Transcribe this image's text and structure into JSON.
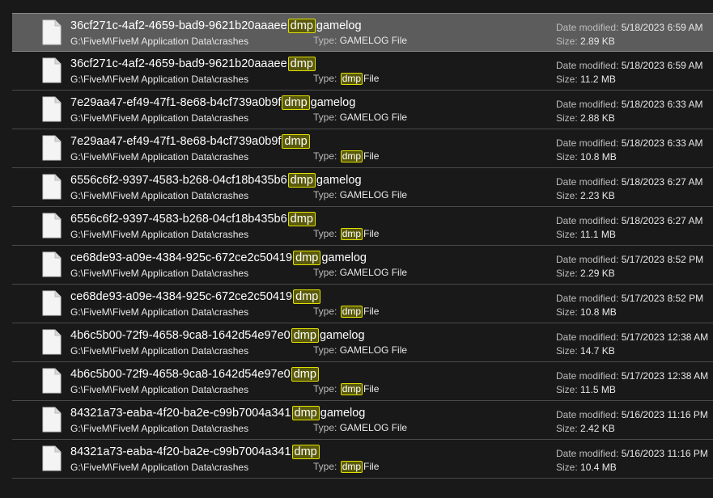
{
  "labels": {
    "type": "Type:",
    "date_modified": "Date modified:",
    "size": "Size:"
  },
  "search_highlight": "dmp",
  "files": [
    {
      "prefix": "36cf271c-4af2-4659-bad9-9621b20aaaee",
      "suffix": "gamelog",
      "path": "G:\\FiveM\\FiveM Application Data\\crashes",
      "type": "GAMELOG File",
      "date": "5/18/2023 6:59 AM",
      "size": "2.89 KB",
      "selected": true
    },
    {
      "prefix": "36cf271c-4af2-4659-bad9-9621b20aaaee",
      "suffix": "",
      "path": "G:\\FiveM\\FiveM Application Data\\crashes",
      "type": "File",
      "date": "5/18/2023 6:59 AM",
      "size": "11.2 MB",
      "selected": false
    },
    {
      "prefix": "7e29aa47-ef49-47f1-8e68-b4cf739a0b9f",
      "suffix": "gamelog",
      "path": "G:\\FiveM\\FiveM Application Data\\crashes",
      "type": "GAMELOG File",
      "date": "5/18/2023 6:33 AM",
      "size": "2.88 KB",
      "selected": false
    },
    {
      "prefix": "7e29aa47-ef49-47f1-8e68-b4cf739a0b9f",
      "suffix": "",
      "path": "G:\\FiveM\\FiveM Application Data\\crashes",
      "type": "File",
      "date": "5/18/2023 6:33 AM",
      "size": "10.8 MB",
      "selected": false
    },
    {
      "prefix": "6556c6f2-9397-4583-b268-04cf18b435b6",
      "suffix": "gamelog",
      "path": "G:\\FiveM\\FiveM Application Data\\crashes",
      "type": "GAMELOG File",
      "date": "5/18/2023 6:27 AM",
      "size": "2.23 KB",
      "selected": false
    },
    {
      "prefix": "6556c6f2-9397-4583-b268-04cf18b435b6",
      "suffix": "",
      "path": "G:\\FiveM\\FiveM Application Data\\crashes",
      "type": "File",
      "date": "5/18/2023 6:27 AM",
      "size": "11.1 MB",
      "selected": false
    },
    {
      "prefix": "ce68de93-a09e-4384-925c-672ce2c50419",
      "suffix": "gamelog",
      "path": "G:\\FiveM\\FiveM Application Data\\crashes",
      "type": "GAMELOG File",
      "date": "5/17/2023 8:52 PM",
      "size": "2.29 KB",
      "selected": false
    },
    {
      "prefix": "ce68de93-a09e-4384-925c-672ce2c50419",
      "suffix": "",
      "path": "G:\\FiveM\\FiveM Application Data\\crashes",
      "type": "File",
      "date": "5/17/2023 8:52 PM",
      "size": "10.8 MB",
      "selected": false
    },
    {
      "prefix": "4b6c5b00-72f9-4658-9ca8-1642d54e97e0",
      "suffix": "gamelog",
      "path": "G:\\FiveM\\FiveM Application Data\\crashes",
      "type": "GAMELOG File",
      "date": "5/17/2023 12:38 AM",
      "size": "14.7 KB",
      "selected": false
    },
    {
      "prefix": "4b6c5b00-72f9-4658-9ca8-1642d54e97e0",
      "suffix": "",
      "path": "G:\\FiveM\\FiveM Application Data\\crashes",
      "type": "File",
      "date": "5/17/2023 12:38 AM",
      "size": "11.5 MB",
      "selected": false
    },
    {
      "prefix": "84321a73-eaba-4f20-ba2e-c99b7004a341",
      "suffix": "gamelog",
      "path": "G:\\FiveM\\FiveM Application Data\\crashes",
      "type": "GAMELOG File",
      "date": "5/16/2023 11:16 PM",
      "size": "2.42 KB",
      "selected": false
    },
    {
      "prefix": "84321a73-eaba-4f20-ba2e-c99b7004a341",
      "suffix": "",
      "path": "G:\\FiveM\\FiveM Application Data\\crashes",
      "type": "File",
      "date": "5/16/2023 11:16 PM",
      "size": "10.4 MB",
      "selected": false
    }
  ]
}
